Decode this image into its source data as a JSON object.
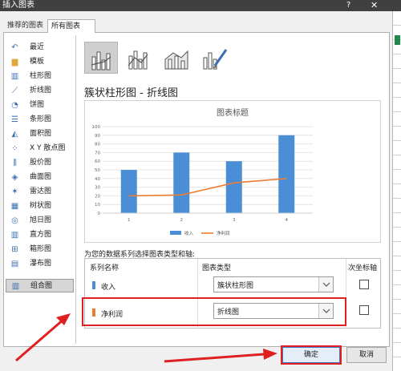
{
  "window": {
    "title": "插入图表",
    "help": "?",
    "close": "✕"
  },
  "tabs": [
    "推荐的图表",
    "所有图表"
  ],
  "sidebar": [
    {
      "label": "最近",
      "icon": "recent-icon"
    },
    {
      "label": "模板",
      "icon": "folder-icon"
    },
    {
      "label": "柱形图",
      "icon": "column-chart-icon"
    },
    {
      "label": "折线图",
      "icon": "line-chart-icon"
    },
    {
      "label": "饼图",
      "icon": "pie-chart-icon"
    },
    {
      "label": "条形图",
      "icon": "bar-chart-icon"
    },
    {
      "label": "面积图",
      "icon": "area-chart-icon"
    },
    {
      "label": "X Y 散点图",
      "icon": "scatter-chart-icon"
    },
    {
      "label": "股价图",
      "icon": "stock-chart-icon"
    },
    {
      "label": "曲面图",
      "icon": "surface-chart-icon"
    },
    {
      "label": "雷达图",
      "icon": "radar-chart-icon"
    },
    {
      "label": "树状图",
      "icon": "treemap-chart-icon"
    },
    {
      "label": "旭日图",
      "icon": "sunburst-chart-icon"
    },
    {
      "label": "直方图",
      "icon": "histogram-chart-icon"
    },
    {
      "label": "箱形图",
      "icon": "box-chart-icon"
    },
    {
      "label": "瀑布图",
      "icon": "waterfall-chart-icon"
    },
    {
      "label": "组合图",
      "icon": "combo-chart-icon"
    }
  ],
  "selected_sidebar": "组合图",
  "subtype_heading": "簇状柱形图 - 折线图",
  "instruction": "为您的数据系列选择图表类型和轴:",
  "grid": {
    "headers": [
      "系列名称",
      "图表类型",
      "次坐标轴"
    ],
    "rows": [
      {
        "name": "收入",
        "type": "簇状柱形图",
        "color": "#4a8fd6",
        "secondary": false
      },
      {
        "name": "净利润",
        "type": "折线图",
        "color": "#ed7d31",
        "secondary": false
      }
    ]
  },
  "buttons": {
    "ok": "确定",
    "cancel": "取消"
  },
  "colors": {
    "bar": "#4a8fd6",
    "line": "#ed7d31",
    "highlight": "#e02020"
  },
  "chart_data": {
    "type": "bar",
    "title": "图表标题",
    "categories": [
      "1",
      "2",
      "3",
      "4"
    ],
    "series": [
      {
        "name": "收入",
        "type": "bar",
        "values": [
          50,
          70,
          60,
          90
        ]
      },
      {
        "name": "净利润",
        "type": "line",
        "values": [
          20,
          21,
          35,
          40
        ]
      }
    ],
    "ylim": [
      0,
      100
    ],
    "yticks": [
      "0",
      "10",
      "20",
      "30",
      "40",
      "50",
      "60",
      "70",
      "80",
      "90",
      "100"
    ],
    "legend": "bottom"
  }
}
